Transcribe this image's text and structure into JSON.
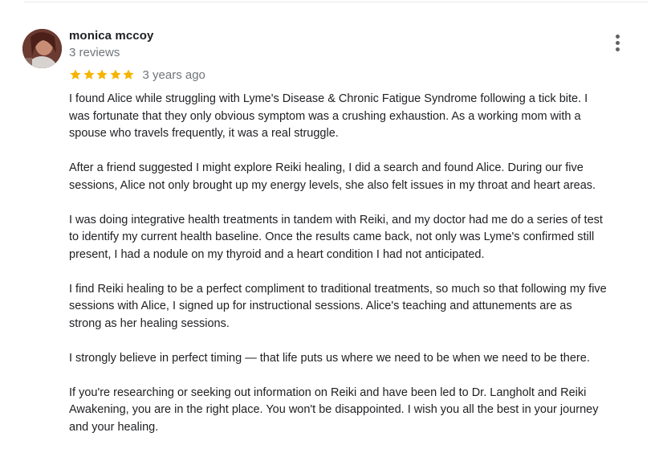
{
  "review": {
    "author_name": "monica mccoy",
    "author_reviews": "3 reviews",
    "rating": 5,
    "rating_max": 5,
    "date": "3 years ago",
    "star_color": "#f5b400",
    "paragraphs": [
      "I found Alice while struggling with Lyme's Disease & Chronic Fatigue Syndrome following a tick bite.  I\nwas fortunate that they only obvious symptom was a crushing exhaustion.  As a working mom with a\nspouse who travels frequently, it was a real struggle.",
      "After a friend suggested I might explore Reiki healing, I did a search and found Alice.  During our five\nsessions, Alice not only brought up my energy levels, she also felt issues in my throat and heart areas.",
      "I was doing integrative health treatments in tandem with Reiki, and my doctor had me do a series of test\nto identify my current health baseline.  Once the results came back, not only was Lyme's confirmed still\npresent, I had a nodule on my thyroid and a heart condition I had not anticipated.",
      "I find Reiki healing to be a perfect compliment to traditional treatments, so much so that following my five\nsessions with Alice, I signed up for instructional sessions.  Alice's teaching and attunements are as\nstrong as her healing sessions.",
      "I strongly believe in perfect timing — that life puts us where we need to be when we need to be there.",
      "If you're researching or seeking out information on Reiki and have been led to Dr. Langholt and Reiki\nAwakening,  you are in the right place.  You won't be disappointed.  I wish you all the best in your journey\nand your healing."
    ]
  },
  "icons": {
    "more": "more-vertical-icon",
    "star": "star-icon"
  }
}
